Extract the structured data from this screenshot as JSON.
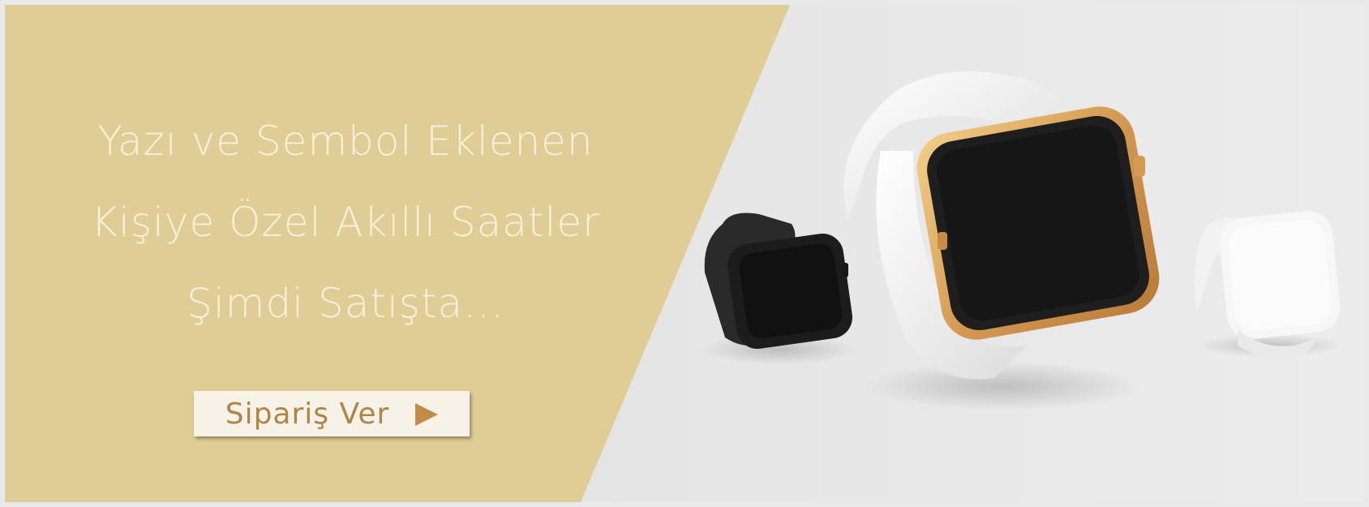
{
  "banner": {
    "headline_lines": [
      "Yazı ve Sembol Eklenen",
      "Kişiye Özel Akıllı Saatler",
      "Şimdi Satışta..."
    ],
    "cta_label": "Sipariş Ver",
    "cta_icon": "play-arrow-icon"
  },
  "colors": {
    "panel_gold": "#e0cd95",
    "headline_text": "#f6f0df",
    "cta_text": "#b08444",
    "cta_arrow": "#c18c4a",
    "background": "#e6e6e6"
  },
  "product_images": [
    "black-smartwatch",
    "gold-white-smartwatch",
    "white-smartwatch"
  ]
}
